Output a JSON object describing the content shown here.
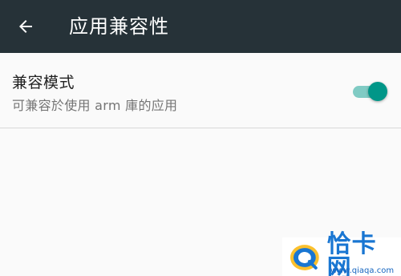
{
  "app_bar": {
    "title": "应用兼容性",
    "back_icon": "arrow-back-icon",
    "background": "#263238"
  },
  "settings": [
    {
      "title": "兼容模式",
      "summary": "可兼容於使用 arm 庫的应用",
      "switch_on": true,
      "accent": "#009688"
    }
  ],
  "watermark": {
    "text": "恰卡网",
    "sub": "www.qiaqa.com",
    "logo_icon": "qiaqa-logo-icon"
  }
}
